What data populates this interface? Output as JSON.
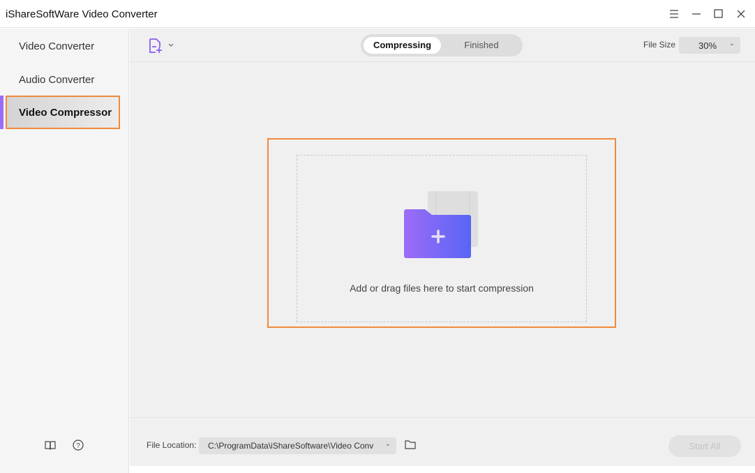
{
  "window": {
    "title": "iShareSoftWare Video Converter"
  },
  "sidebar": {
    "items": [
      {
        "label": "Video Converter"
      },
      {
        "label": "Audio Converter"
      },
      {
        "label": "Video Compressor",
        "active": true
      }
    ]
  },
  "toolbar": {
    "tabs": [
      {
        "label": "Compressing",
        "active": true
      },
      {
        "label": "Finished"
      }
    ],
    "file_size_label": "File Size",
    "file_size_value": "30%"
  },
  "dropzone": {
    "text": "Add or drag files here to start compression"
  },
  "footer": {
    "file_location_label": "File Location:",
    "file_location_value": "C:\\ProgramData\\iShareSoftware\\Video Conv",
    "start_all_label": "Start All"
  },
  "colors": {
    "accent": "#9b6cf5",
    "highlight": "#f08a3c",
    "folder_start": "#9d6cf7",
    "folder_end": "#5865f5"
  }
}
